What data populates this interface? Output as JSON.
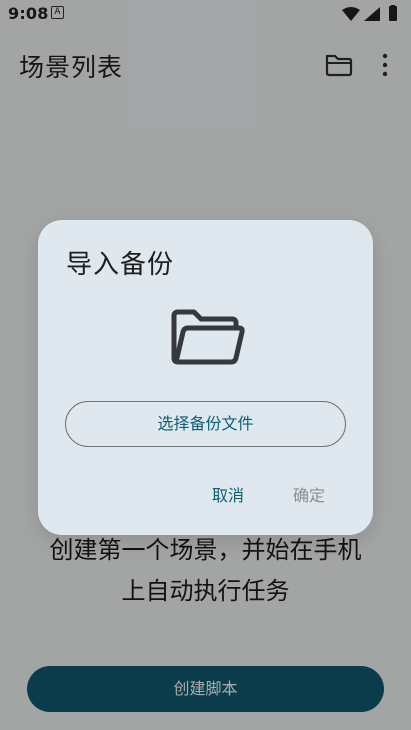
{
  "status_bar": {
    "time": "9:08",
    "app_badge": "A",
    "wifi_icon": "wifi-icon",
    "signal_icon": "signal-icon",
    "battery_icon": "battery-icon"
  },
  "header": {
    "title": "场景列表",
    "folder_icon": "folder-icon",
    "more_icon": "more-vert-icon"
  },
  "main": {
    "empty_message_line1": "创建第一个场景，并始在手机",
    "empty_message_line2": "上自动执行任务",
    "create_script_label": "创建脚本"
  },
  "dialog": {
    "title": "导入备份",
    "folder_icon": "folder-icon",
    "choose_file_label": "选择备份文件",
    "cancel_label": "取消",
    "confirm_label": "确定"
  },
  "colors": {
    "primary": "#0d5d73",
    "button_fill": "#0f5a70",
    "dialog_background": "#dfe8ef",
    "disabled_text": "#8a8f94"
  }
}
